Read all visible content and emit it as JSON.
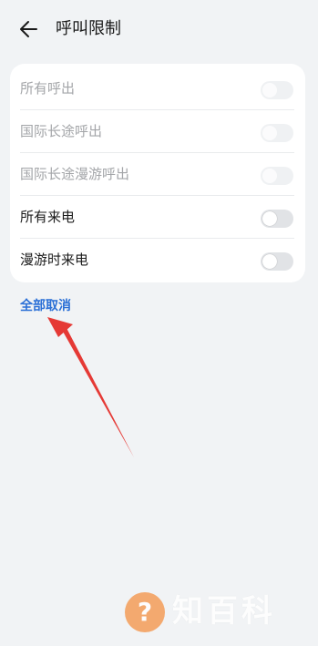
{
  "header": {
    "back_icon": "arrow-left-icon",
    "title": "呼叫限制"
  },
  "rows": [
    {
      "label": "所有呼出",
      "enabled": false,
      "on": false
    },
    {
      "label": "国际长途呼出",
      "enabled": false,
      "on": false
    },
    {
      "label": "国际长途漫游呼出",
      "enabled": false,
      "on": false
    },
    {
      "label": "所有来电",
      "enabled": true,
      "on": false
    },
    {
      "label": "漫游时来电",
      "enabled": true,
      "on": false
    }
  ],
  "actions": {
    "cancel_all": "全部取消"
  },
  "colors": {
    "background": "#f1f3f5",
    "card": "#ffffff",
    "link": "#2a6fd6",
    "annotation_arrow": "#e53935",
    "watermark_icon": "#f4a261"
  },
  "watermark": {
    "icon": "question-mark-icon",
    "icon_glyph": "?",
    "text": "知百科"
  }
}
